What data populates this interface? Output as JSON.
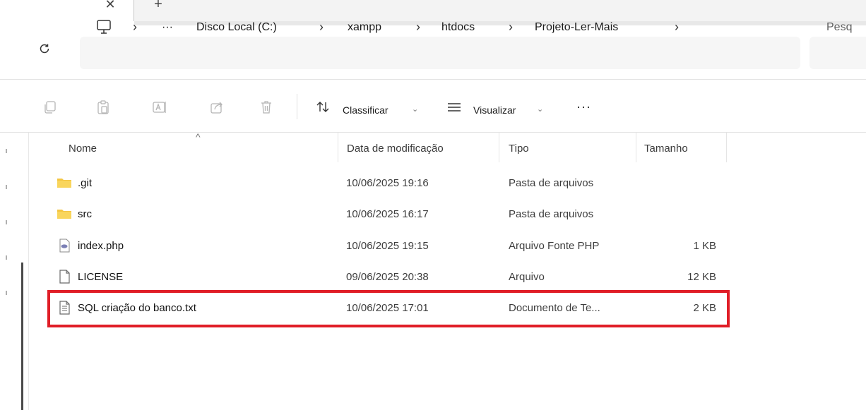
{
  "tabs": {
    "close_glyph": "✕",
    "new_glyph": "+"
  },
  "address": {
    "refresh_icon": "refresh-icon",
    "overflow": "···",
    "crumbs": [
      "Disco Local (C:)",
      "xampp",
      "htdocs",
      "Projeto-Ler-Mais"
    ],
    "search_placeholder": "Pesq"
  },
  "toolbar": {
    "sort_label": "Classificar",
    "view_label": "Visualizar",
    "more": "···"
  },
  "columns": {
    "name": "Nome",
    "date": "Data de modificação",
    "type": "Tipo",
    "size": "Tamanho"
  },
  "files": [
    {
      "name": ".git",
      "date": "10/06/2025 19:16",
      "type": "Pasta de arquivos",
      "size": "",
      "icon": "folder-icon"
    },
    {
      "name": "src",
      "date": "10/06/2025 16:17",
      "type": "Pasta de arquivos",
      "size": "",
      "icon": "folder-icon"
    },
    {
      "name": "index.php",
      "date": "10/06/2025 19:15",
      "type": "Arquivo Fonte PHP",
      "size": "1 KB",
      "icon": "php-file-icon"
    },
    {
      "name": "LICENSE",
      "date": "09/06/2025 20:38",
      "type": "Arquivo",
      "size": "12 KB",
      "icon": "blank-file-icon"
    },
    {
      "name": "SQL criação do banco.txt",
      "date": "10/06/2025 17:01",
      "type": "Documento de Te...",
      "size": "2 KB",
      "icon": "text-file-icon"
    }
  ],
  "colors": {
    "highlight": "#e01e27",
    "folder": "#f4c542"
  }
}
